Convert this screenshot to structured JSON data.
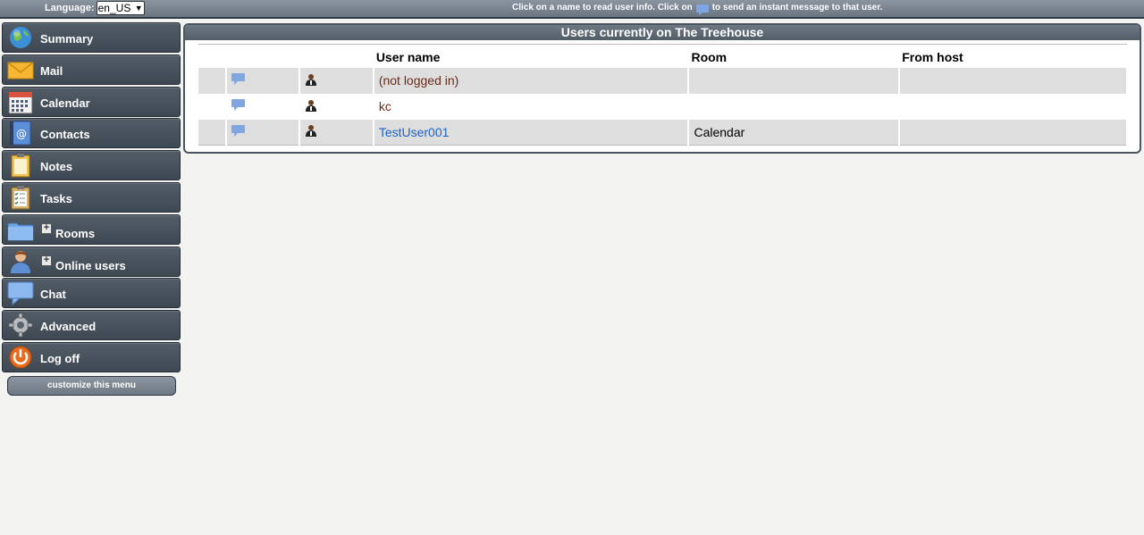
{
  "topbar": {
    "language_label": "Language:",
    "language_value": "en_US",
    "hint_before": "Click on a name to read user info. Click on",
    "hint_after": "to send an instant message to that user."
  },
  "sidebar": {
    "items": [
      {
        "label": "Summary"
      },
      {
        "label": "Mail"
      },
      {
        "label": "Calendar"
      },
      {
        "label": "Contacts"
      },
      {
        "label": "Notes"
      },
      {
        "label": "Tasks"
      },
      {
        "label": "Rooms",
        "expandable": true
      },
      {
        "label": "Online users",
        "expandable": true
      },
      {
        "label": "Chat"
      },
      {
        "label": "Advanced"
      },
      {
        "label": "Log off"
      }
    ],
    "customize_label": "customize this menu",
    "plus": "+"
  },
  "main": {
    "title": "Users currently on The Treehouse",
    "columns": [
      "User name",
      "Room",
      "From host"
    ],
    "rows": [
      {
        "user": "(not logged in)",
        "room": "",
        "host": ""
      },
      {
        "user": "kc",
        "room": "",
        "host": ""
      },
      {
        "user": "TestUser001",
        "room": "Calendar",
        "host": ""
      }
    ]
  },
  "colors": {
    "nav_bg": "#46515c",
    "link": "#1a63c9",
    "dark_name": "#6a2a1a",
    "row_alt": "#dedede"
  },
  "icons": [
    "globe-icon",
    "mail-icon",
    "calendar-icon",
    "contacts-icon",
    "notes-icon",
    "tasks-icon",
    "folder-icon",
    "user-icon",
    "chat-icon",
    "gear-icon",
    "power-icon",
    "chat-bubble-icon",
    "person-icon",
    "plus-icon"
  ]
}
